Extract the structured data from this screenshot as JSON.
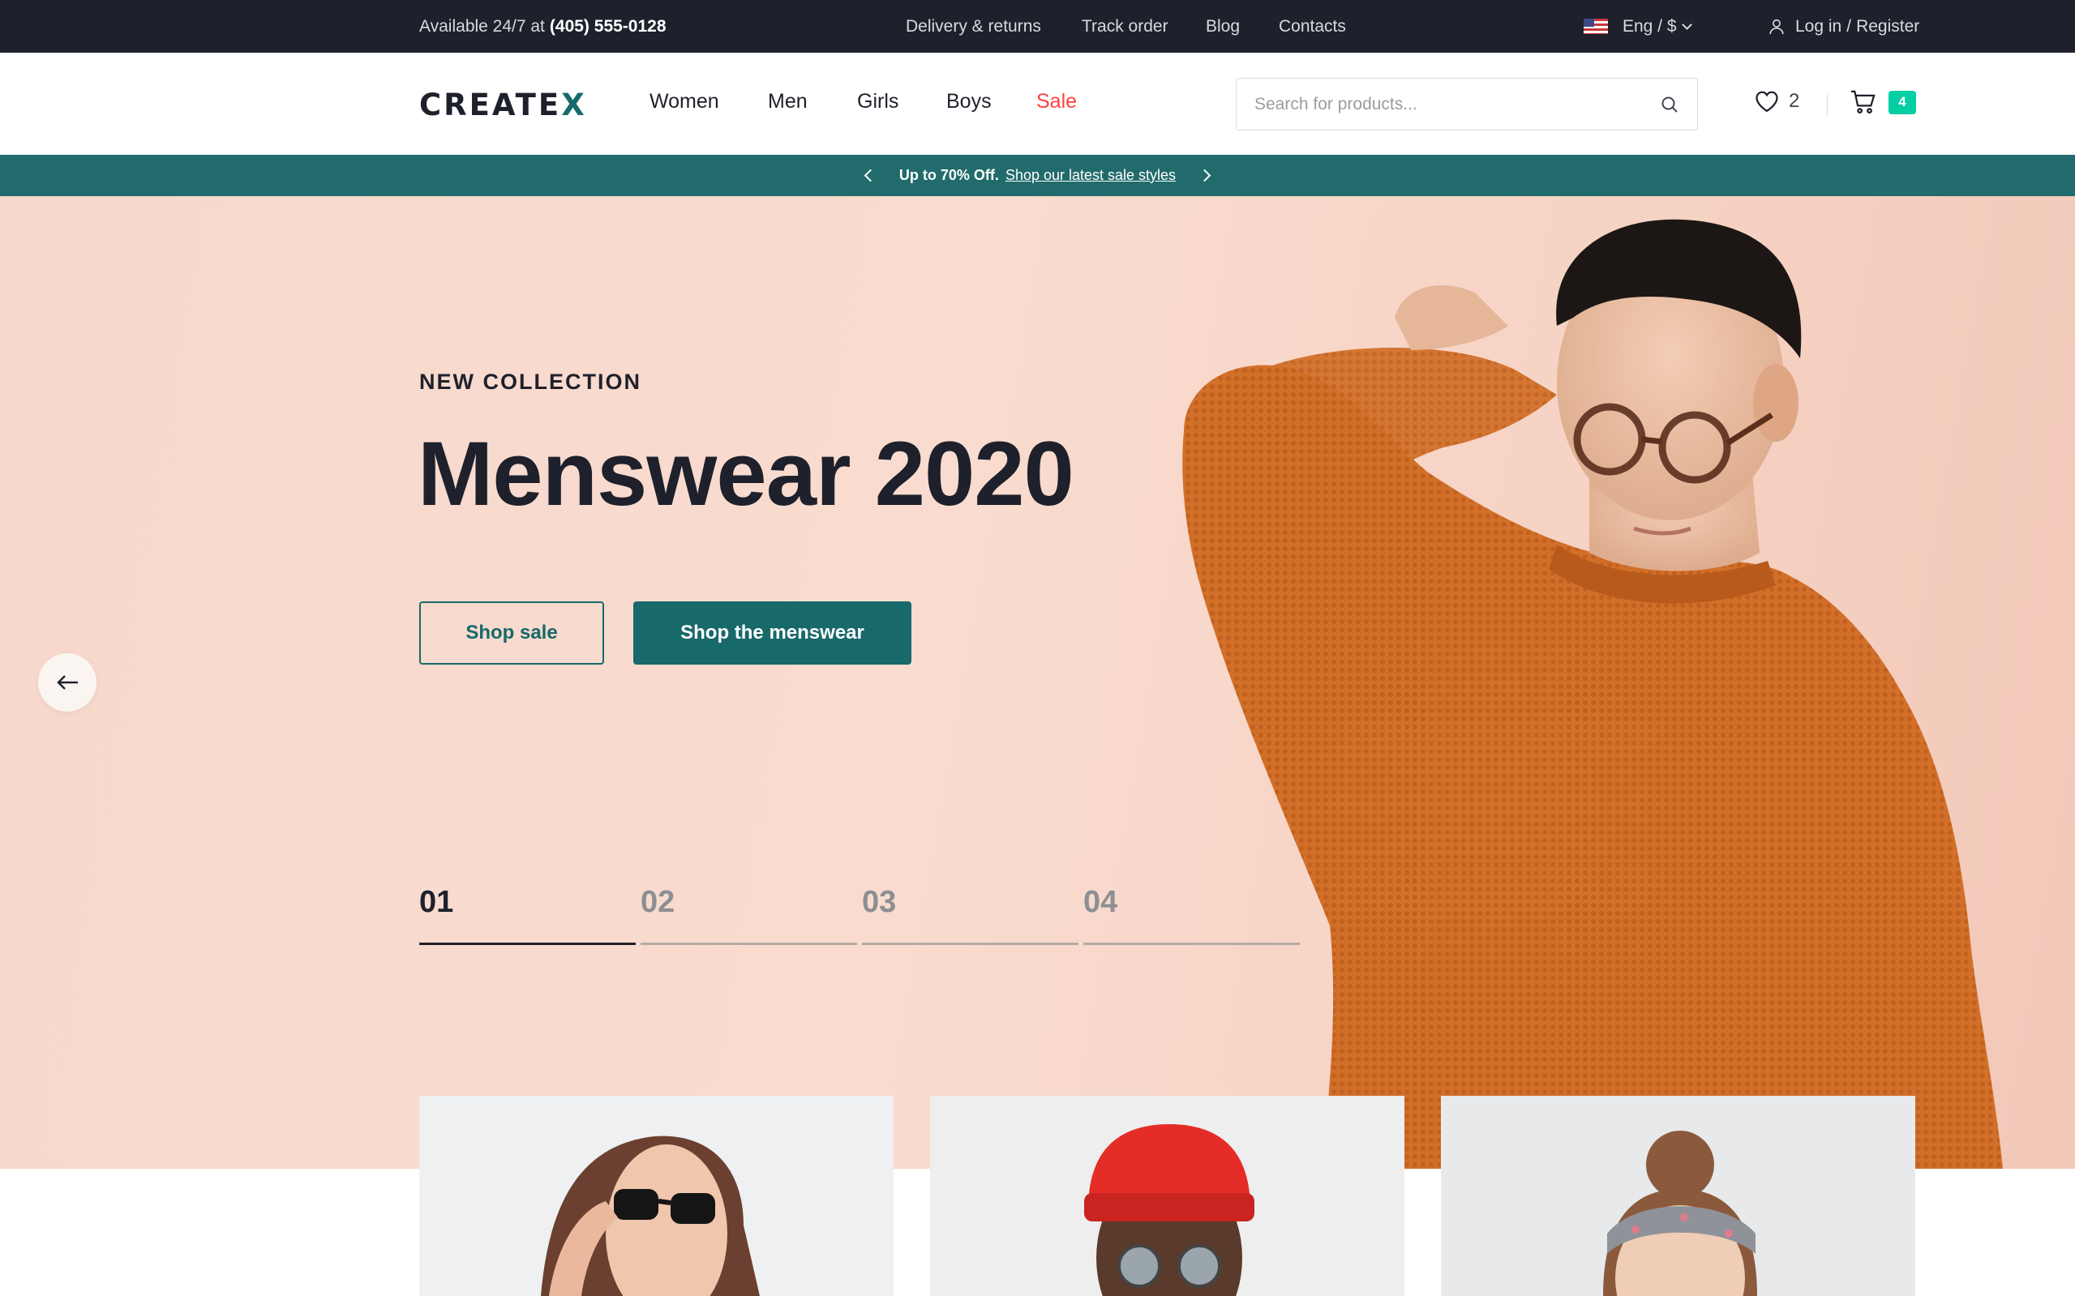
{
  "topbar": {
    "availability": "Available 24/7 at",
    "phone": "(405) 555-0128",
    "links": [
      "Delivery & returns",
      "Track order",
      "Blog",
      "Contacts"
    ],
    "locale": "Eng / $",
    "login": "Log in",
    "separator": "/",
    "register": "Register"
  },
  "header": {
    "logo_main": "CREATE",
    "logo_x": "X",
    "nav": [
      "Women",
      "Men",
      "Girls",
      "Boys",
      "Sale"
    ],
    "search_placeholder": "Search for products...",
    "wishlist_count": "2",
    "cart_count": "4"
  },
  "promo": {
    "bold": "Up to 70% Off.",
    "link": "Shop our latest sale styles"
  },
  "hero": {
    "eyebrow": "NEW COLLECTION",
    "title": "Menswear 2020",
    "btn_secondary": "Shop sale",
    "btn_primary": "Shop the menswear",
    "slides": [
      "01",
      "02",
      "03",
      "04"
    ],
    "active_slide": "01"
  },
  "colors": {
    "dark": "#1e212c",
    "primary": "#17696a",
    "promo_bg": "#226b6c",
    "sale_red": "#ff4242",
    "badge_green": "#03cea4",
    "hero_bg": "#f7d8cc",
    "sweater_orange": "#d46f26"
  },
  "icons": [
    "flag-us-icon",
    "chevron-down-icon",
    "user-icon",
    "search-icon",
    "heart-icon",
    "cart-icon",
    "chevron-left-icon",
    "chevron-right-icon",
    "arrow-left-icon"
  ]
}
